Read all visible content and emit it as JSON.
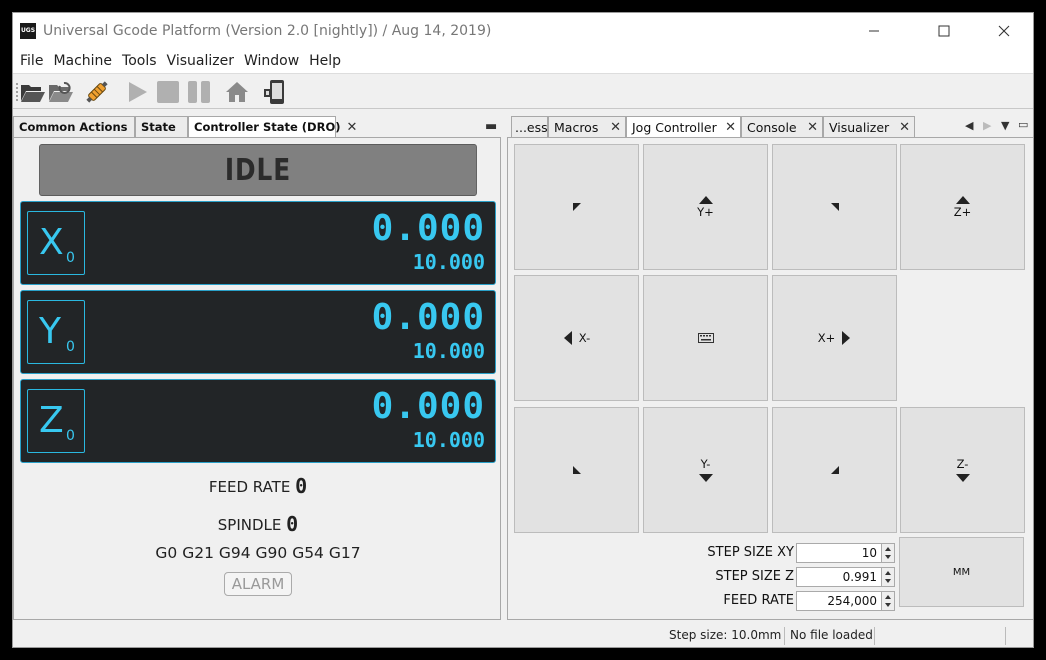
{
  "window": {
    "title": "Universal Gcode Platform (Version 2.0 [nightly])  / Aug 14, 2019)",
    "logo_text": "UGS"
  },
  "menu": [
    "File",
    "Machine",
    "Tools",
    "Visualizer",
    "Window",
    "Help"
  ],
  "toolbar": {
    "buttons": [
      "open-folder-icon",
      "recent-files-icon",
      "connect-plug-icon",
      "play-icon",
      "stop-icon",
      "pause-icon",
      "home-icon",
      "mobile-device-icon"
    ]
  },
  "left_panel": {
    "tabs": [
      {
        "label": "Common Actions"
      },
      {
        "label": "State"
      },
      {
        "label": "Controller State (DRO)",
        "close": "✕"
      }
    ],
    "minimize": "▬",
    "state": "IDLE",
    "axes": [
      {
        "letter": "X",
        "sub": "0",
        "work": "0.000",
        "machine": "10.000"
      },
      {
        "letter": "Y",
        "sub": "0",
        "work": "0.000",
        "machine": "10.000"
      },
      {
        "letter": "Z",
        "sub": "0",
        "work": "0.000",
        "machine": "10.000"
      }
    ],
    "feed_rate_label": "FEED RATE",
    "feed_rate_value": "0",
    "spindle_label": "SPINDLE",
    "spindle_value": "0",
    "gcodes": "G0 G21 G94 G90 G54 G17",
    "alarm": "ALARM"
  },
  "right_panel": {
    "tabs": [
      {
        "label": "...ess"
      },
      {
        "label": "Macros",
        "close": "✕"
      },
      {
        "label": "Jog Controller",
        "close": "✕"
      },
      {
        "label": "Console",
        "close": "✕"
      },
      {
        "label": "Visualizer",
        "close": "✕"
      }
    ],
    "jog": {
      "y_plus": "Y+",
      "z_plus": "Z+",
      "x_minus": "X-",
      "x_plus": "X+",
      "y_minus": "Y-",
      "z_minus": "Z-"
    },
    "step_xy_label": "STEP SIZE XY",
    "step_xy_value": "10",
    "step_z_label": "STEP SIZE Z",
    "step_z_value": "0.991",
    "feed_label": "FEED RATE",
    "feed_value": "254,000",
    "units": "MM"
  },
  "status": {
    "step_size": "Step size: 10.0mm",
    "file": "No file loaded"
  },
  "colors": {
    "dro_text": "#38c8f0",
    "dro_bg": "#222527",
    "state_bg": "#808080"
  }
}
